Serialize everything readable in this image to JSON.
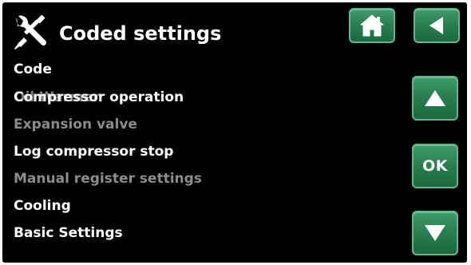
{
  "header": {
    "title": "Coded settings",
    "title_icon": "tools-icon"
  },
  "buttons": {
    "home_icon": "home-icon",
    "back_icon": "back-arrow-icon",
    "up_icon": "up-arrow-icon",
    "ok_label": "OK",
    "down_icon": "down-arrow-icon"
  },
  "menu": {
    "items": [
      {
        "label": "Code",
        "state": "enabled"
      },
      {
        "label": "Compressor operation",
        "state": "enabled"
      },
      {
        "label": "Expansion valve",
        "state": "disabled"
      },
      {
        "label": "Log compressor stop",
        "state": "enabled"
      },
      {
        "label": "Manual register settings",
        "state": "disabled"
      },
      {
        "label": "Cooling",
        "state": "enabled"
      },
      {
        "label": "Basic Settings",
        "state": "enabled"
      }
    ],
    "ghost_label": "Oil Warmer"
  },
  "colors": {
    "background": "#000000",
    "button_green": "#2a7f50",
    "enabled_text": "#ffffff",
    "disabled_text": "#8c8c8c"
  }
}
